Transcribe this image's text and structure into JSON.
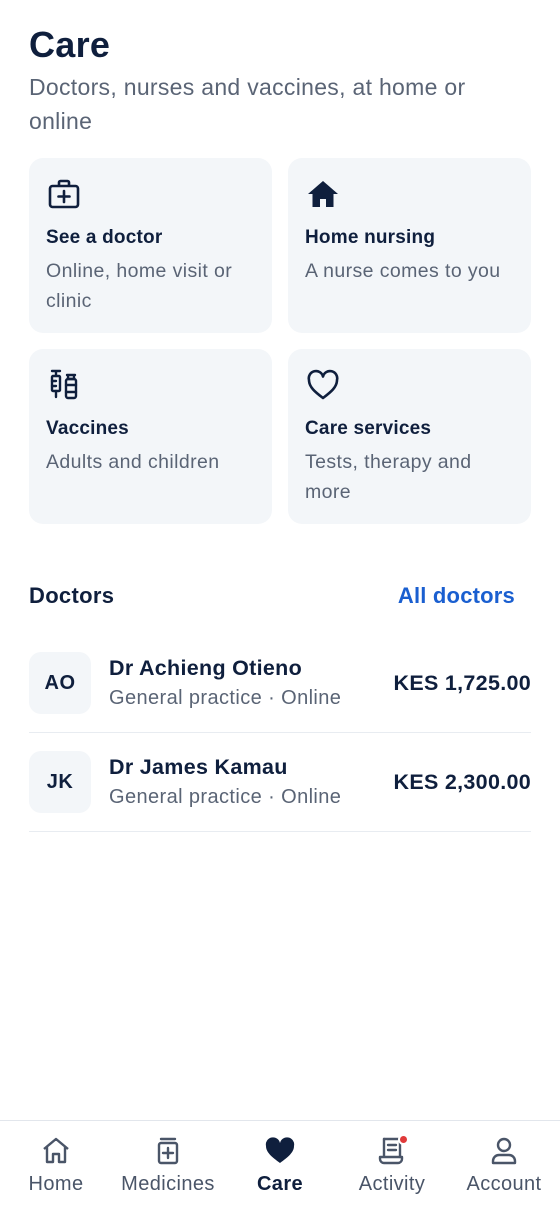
{
  "header": {
    "title": "Care",
    "subtitle": "Doctors, nurses and vaccines, at home or online"
  },
  "tiles": [
    {
      "icon": "medical-bag-icon",
      "title": "See a doctor",
      "desc": "Online, home visit or clinic"
    },
    {
      "icon": "home-icon",
      "title": "Home nursing",
      "desc": "A nurse comes to you"
    },
    {
      "icon": "vaccine-icon",
      "title": "Vaccines",
      "desc": "Adults and children"
    },
    {
      "icon": "heart-outline-icon",
      "title": "Care services",
      "desc": "Tests, therapy and more"
    }
  ],
  "doctors_section": {
    "title": "Doctors",
    "link": "All doctors",
    "items": [
      {
        "initials": "AO",
        "name": "Dr Achieng Otieno",
        "specialty": "General practice · Online",
        "price": "KES 1,725.00"
      },
      {
        "initials": "JK",
        "name": "Dr James Kamau",
        "specialty": "General practice · Online",
        "price": "KES 2,300.00"
      }
    ]
  },
  "nav": {
    "items": [
      {
        "icon": "home-icon",
        "label": "Home"
      },
      {
        "icon": "medicine-icon",
        "label": "Medicines"
      },
      {
        "icon": "heart-icon",
        "label": "Care"
      },
      {
        "icon": "receipt-icon",
        "label": "Activity"
      },
      {
        "icon": "user-icon",
        "label": "Account"
      }
    ],
    "active": "Care",
    "notification_on": "Activity"
  },
  "colors": {
    "primary_text": "#0f1f3d",
    "secondary_text": "#5a6475",
    "link": "#1a5fd0",
    "tile_bg": "#f3f6f9",
    "badge": "#e03a3a"
  }
}
